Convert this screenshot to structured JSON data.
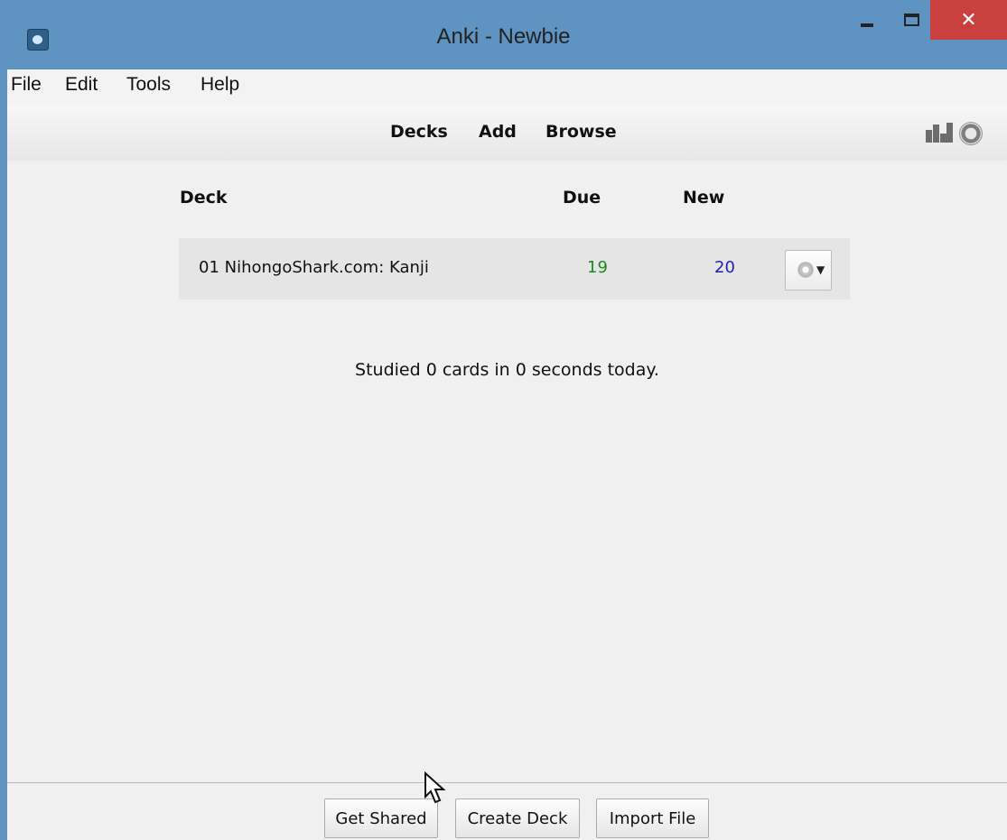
{
  "window": {
    "title": "Anki - Newbie",
    "close_glyph": "✕",
    "icons": [
      "anki-app-icon",
      "minimize-icon",
      "maximize-icon",
      "close-icon"
    ]
  },
  "menubar": {
    "items": [
      {
        "label": "File"
      },
      {
        "label": "Edit"
      },
      {
        "label": "Tools"
      },
      {
        "label": "Help"
      }
    ]
  },
  "toolbar": {
    "links": [
      {
        "label": "Decks"
      },
      {
        "label": "Add"
      },
      {
        "label": "Browse"
      }
    ],
    "right_icons": [
      "stats-icon",
      "sync-icon"
    ]
  },
  "deck_list": {
    "headers": {
      "deck": "Deck",
      "due": "Due",
      "new": "New"
    },
    "decks": [
      {
        "name": "01 NihongoShark.com: Kanji",
        "due": "19",
        "new": "20",
        "options_icon": "gear-icon"
      }
    ],
    "colors": {
      "due": "#1b8a1b",
      "new": "#1f1fb8"
    }
  },
  "studied_text": "Studied 0 cards in 0 seconds today.",
  "bottom_buttons": {
    "get_shared": "Get Shared",
    "create_deck": "Create Deck",
    "import_file": "Import File"
  },
  "colors": {
    "titlebar": "#5f93c1",
    "close_button": "#c9403f"
  }
}
